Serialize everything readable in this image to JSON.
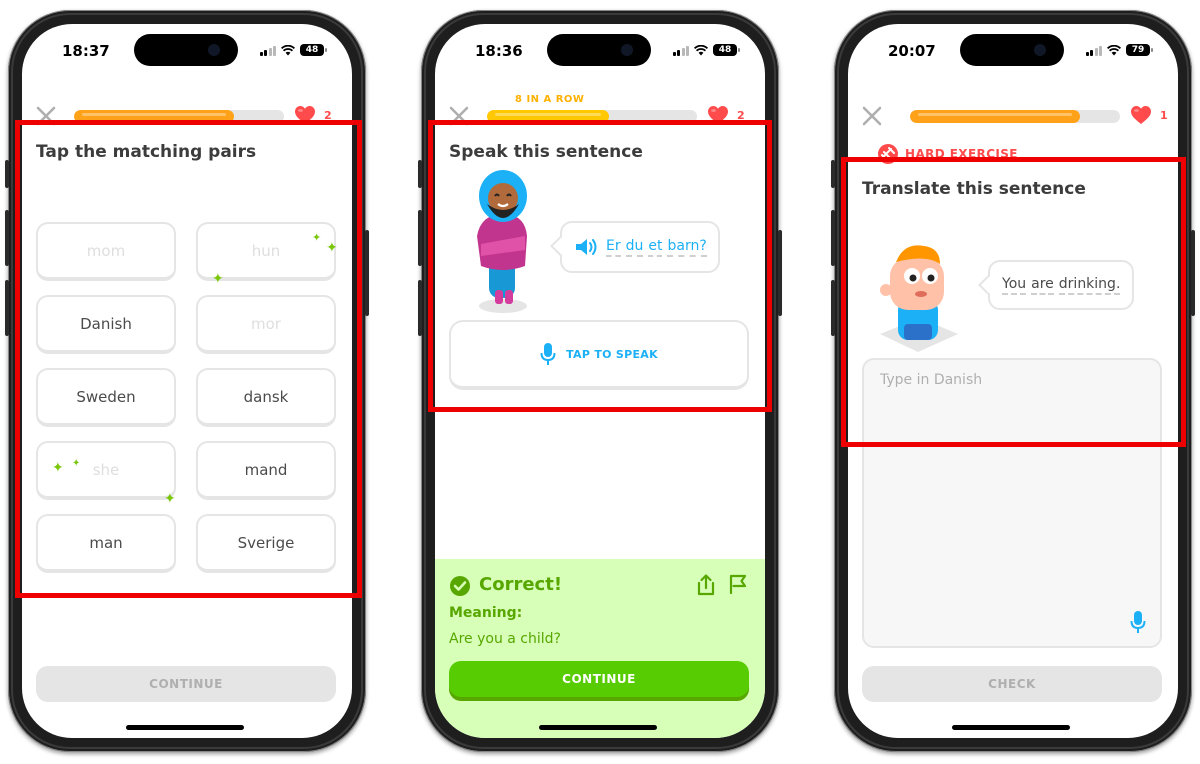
{
  "screen1": {
    "status": {
      "time": "18:37",
      "battery": "48"
    },
    "hearts": "2",
    "progress": 0.76,
    "prompt": "Tap the matching pairs",
    "tiles": [
      {
        "label": "mom",
        "state": "matched"
      },
      {
        "label": "hun",
        "state": "matched"
      },
      {
        "label": "Danish",
        "state": "active"
      },
      {
        "label": "mor",
        "state": "matched"
      },
      {
        "label": "Sweden",
        "state": "active"
      },
      {
        "label": "dansk",
        "state": "active"
      },
      {
        "label": "she",
        "state": "matched"
      },
      {
        "label": "mand",
        "state": "active"
      },
      {
        "label": "man",
        "state": "active"
      },
      {
        "label": "Sverige",
        "state": "active"
      }
    ],
    "continue_label": "CONTINUE"
  },
  "screen2": {
    "status": {
      "time": "18:36",
      "battery": "48"
    },
    "streak_label": "8 IN A ROW",
    "hearts": "2",
    "progress": 0.58,
    "prompt": "Speak this sentence",
    "speech_bubble": {
      "words": [
        "Er",
        "du",
        "et",
        "barn?"
      ]
    },
    "tap_to_speak_label": "TAP TO SPEAK",
    "feedback": {
      "title": "Correct!",
      "meaning_label": "Meaning:",
      "meaning_text": "Are you a child?"
    },
    "continue_label": "CONTINUE"
  },
  "screen3": {
    "status": {
      "time": "20:07",
      "battery": "79"
    },
    "hearts": "1",
    "progress": 0.81,
    "badge": "HARD EXERCISE",
    "prompt": "Translate this sentence",
    "speech_bubble": {
      "words": [
        "You",
        "are",
        "drinking."
      ]
    },
    "input_placeholder": "Type in Danish",
    "check_label": "CHECK"
  },
  "colors": {
    "progress_fill": "#ffa21a",
    "heart": "#ff4b4b",
    "correct_green": "#58cc02",
    "feedback_bg": "#d7ffb8",
    "link_blue": "#1cb0f6",
    "annotation_red": "#ee0000"
  },
  "icons": [
    "close-icon",
    "heart-icon",
    "speaker-icon",
    "microphone-icon",
    "check-circle-icon",
    "share-icon",
    "flag-icon",
    "hard-exercise-icon"
  ]
}
